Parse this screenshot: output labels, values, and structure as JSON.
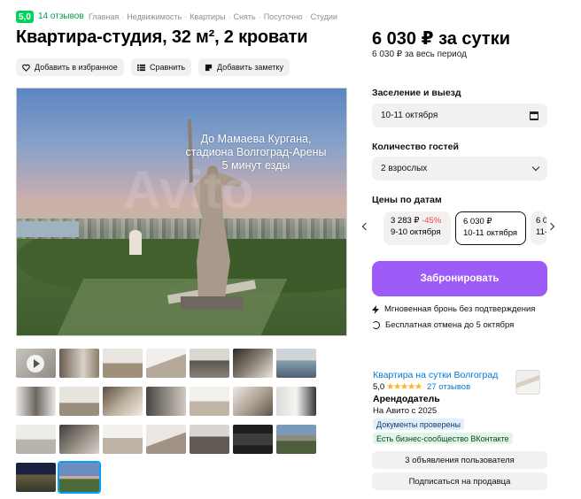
{
  "header": {
    "rating": "5,0",
    "reviews": "14 отзывов",
    "breadcrumbs": [
      "Главная",
      "Недвижимость",
      "Квартиры",
      "Снять",
      "Посуточно",
      "Студии"
    ],
    "breadcrumb_separator": "·",
    "title": "Квартира-студия, 32 м², 2 кровати"
  },
  "actions": {
    "favorite": "Добавить в избранное",
    "compare": "Сравнить",
    "note": "Добавить заметку"
  },
  "photo": {
    "overlay_text": [
      "До Мамаева Кургана,",
      "стадиона Волгоград-Арены",
      "5 минут езды"
    ]
  },
  "price": {
    "main": "6 030 ₽ за сутки",
    "period": "6 030 ₽ за весь период"
  },
  "booking": {
    "checkin_label": "Заселение и выезд",
    "checkin_value": "10-11 октября",
    "guests_label": "Количество гостей",
    "guests_value": "2 взрослых",
    "prices_label": "Цены по датам",
    "date_cards": [
      {
        "price": "3 283 ₽",
        "discount": "-45%",
        "dates": "9-10 октября"
      },
      {
        "price": "6 030 ₽",
        "discount": "",
        "dates": "10-11 октября"
      },
      {
        "price": "6 0",
        "discount": "",
        "dates": "11-"
      }
    ],
    "book_button": "Забронировать",
    "instant": "Мгновенная бронь без подтверждения",
    "cancel": "Бесплатная отмена до 5 октября"
  },
  "seller": {
    "name": "Квартира на сутки Волгоград",
    "rating": "5,0",
    "stars": "★★★★★",
    "reviews": "27 отзывов",
    "role": "Арендодатель",
    "since": "На Авито с 2025",
    "badge_docs": "Документы проверены",
    "badge_vk": "Есть бизнес-сообщество ВКонтакте",
    "listings_button": "3 объявления пользователя",
    "subscribe_button": "Подписаться на продавца"
  },
  "colors": {
    "accent": "#9d5cf7",
    "rating_green": "#02d15c",
    "link_blue": "#0278d6",
    "discount_red": "#ff4053"
  }
}
